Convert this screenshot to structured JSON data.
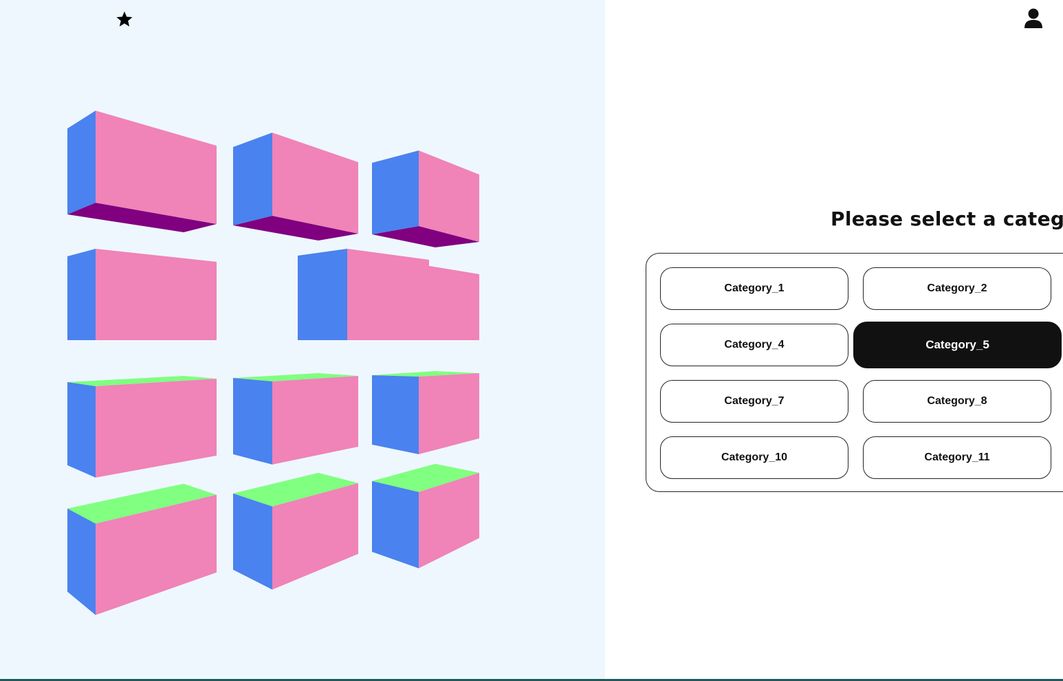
{
  "icons": {
    "top_left": "star-icon",
    "top_right": "user-icon"
  },
  "colors": {
    "left_background": "#eef7fe",
    "box_front": "#f083b8",
    "box_side": "#4a82ef",
    "box_bottom": "#800080",
    "box_top": "#80ff80",
    "selected_button": "#111111"
  },
  "main": {
    "heading": "Please select a categorie",
    "categories": [
      {
        "label": "Category_1",
        "selected": false
      },
      {
        "label": "Category_2",
        "selected": false
      },
      {
        "label": "Category_4",
        "selected": false
      },
      {
        "label": "Category_5",
        "selected": true
      },
      {
        "label": "Category_7",
        "selected": false
      },
      {
        "label": "Category_8",
        "selected": false
      },
      {
        "label": "Category_10",
        "selected": false
      },
      {
        "label": "Category_11",
        "selected": false
      }
    ]
  }
}
